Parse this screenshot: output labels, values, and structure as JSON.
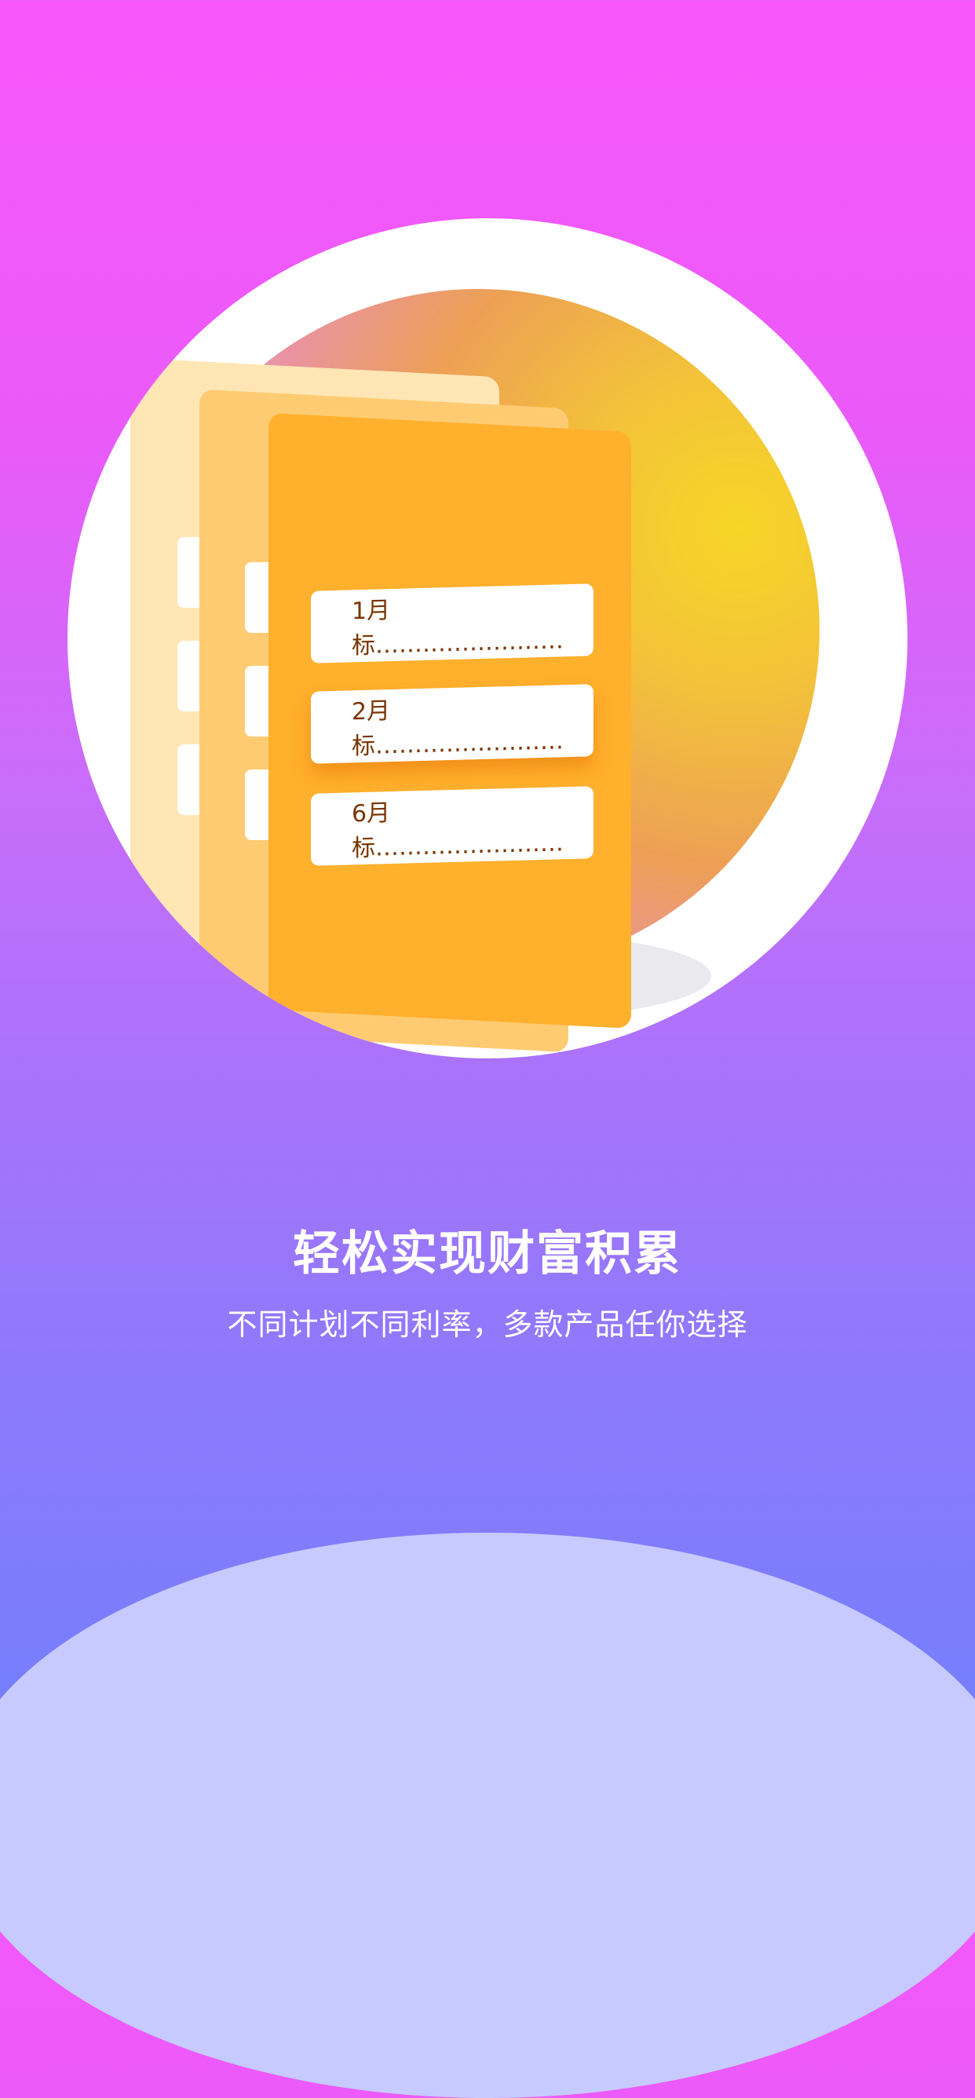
{
  "illustration": {
    "entries": [
      {
        "label": "1月标……………………"
      },
      {
        "label": "2月标……………………"
      },
      {
        "label": "6月标……………………"
      }
    ]
  },
  "intro": {
    "title": "轻松实现财富积累",
    "subtitle": "不同计划不同利率，多款产品任你选择"
  },
  "colors": {
    "background_top": "#f857fb",
    "background_bottom": "#737ffd",
    "folder_front": "#ffb02d",
    "entry_text": "#7a3400"
  }
}
